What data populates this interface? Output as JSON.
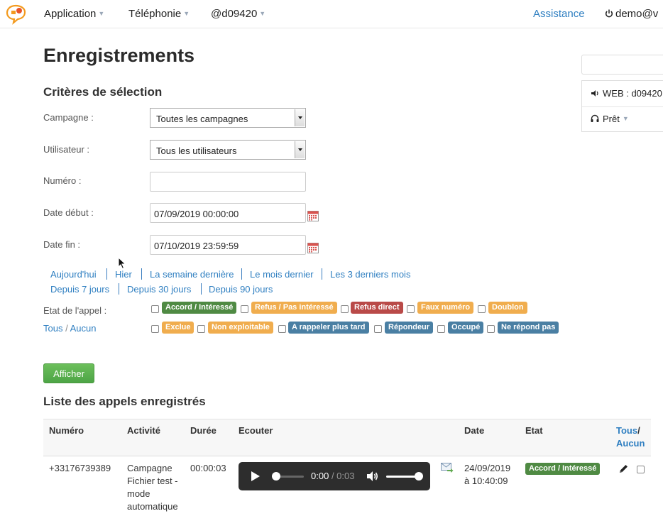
{
  "nav": {
    "items": [
      {
        "label": "Application"
      },
      {
        "label": "Téléphonie"
      },
      {
        "label": "@d09420"
      }
    ],
    "assistance": "Assistance",
    "user": "demo@v"
  },
  "page": {
    "title": "Enregistrements",
    "criteria_title": "Critères de sélection",
    "list_title": "Liste des appels enregistrés"
  },
  "form": {
    "campagne_label": "Campagne :",
    "campagne_value": "Toutes les campagnes",
    "utilisateur_label": "Utilisateur :",
    "utilisateur_value": "Tous les utilisateurs",
    "numero_label": "Numéro :",
    "numero_value": "",
    "date_debut_label": "Date début :",
    "date_debut_value": "07/09/2019 00:00:00",
    "date_fin_label": "Date fin :",
    "date_fin_value": "07/10/2019 23:59:59",
    "etat_label": "Etat de l'appel :",
    "tous": "Tous",
    "slash": "/",
    "aucun": "Aucun",
    "submit": "Afficher"
  },
  "quick_links": [
    "Aujourd'hui",
    "Hier",
    "La semaine dernière",
    "Le mois dernier",
    "Les 3 derniers mois",
    "Depuis 7 jours",
    "Depuis 30 jours",
    "Depuis 90 jours"
  ],
  "states": [
    {
      "label": "Accord / Intéressé",
      "color": "#4f8a43"
    },
    {
      "label": "Refus / Pas intéressé",
      "color": "#f0ad4e"
    },
    {
      "label": "Refus direct",
      "color": "#b94a48"
    },
    {
      "label": "Faux numéro",
      "color": "#f0ad4e"
    },
    {
      "label": "Doublon",
      "color": "#f0ad4e"
    },
    {
      "label": "Exclue",
      "color": "#f0ad4e"
    },
    {
      "label": "Non exploitable",
      "color": "#f0ad4e"
    },
    {
      "label": "A rappeler plus tard",
      "color": "#4a7fa3"
    },
    {
      "label": "Répondeur",
      "color": "#4a7fa3"
    },
    {
      "label": "Occupé",
      "color": "#4a7fa3"
    },
    {
      "label": "Ne répond pas",
      "color": "#4a7fa3"
    }
  ],
  "right_panel": {
    "line": "WEB : d09420",
    "status": "Prêt"
  },
  "table": {
    "headers": {
      "numero": "Numéro",
      "activite": "Activité",
      "duree": "Durée",
      "ecouter": "Ecouter",
      "date": "Date",
      "etat": "Etat",
      "tous": "Tous",
      "slash": "/",
      "aucun": "Aucun"
    },
    "rows": [
      {
        "numero": "+33176739389",
        "activite": [
          "Campagne",
          "Fichier test -",
          "mode",
          "automatique"
        ],
        "duree": "00:00:03",
        "player_time": "0:00",
        "player_duration": "/ 0:03",
        "progress": 0.0,
        "volume": 1.0,
        "date": [
          "24/09/2019",
          "à 10:40:09"
        ],
        "etat": "Accord / Intéressé",
        "etat_color": "#4f8a43"
      }
    ]
  }
}
